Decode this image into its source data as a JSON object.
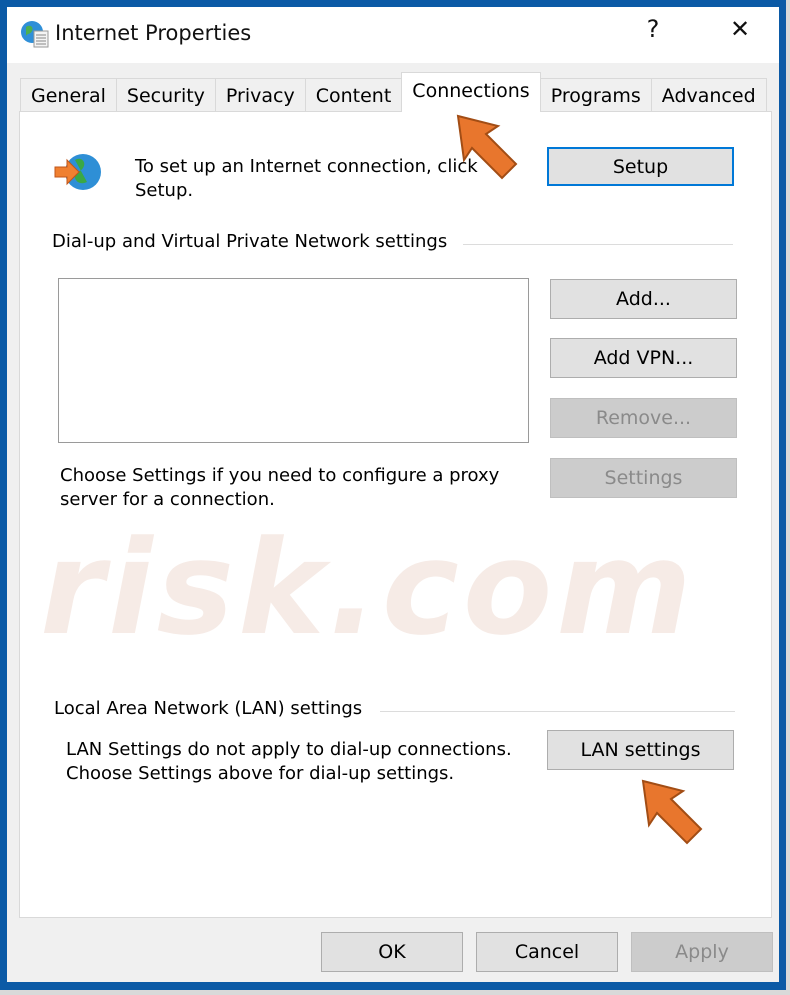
{
  "window": {
    "title": "Internet Properties",
    "help": "?",
    "close": "✕"
  },
  "tabs": [
    {
      "label": "General"
    },
    {
      "label": "Security"
    },
    {
      "label": "Privacy"
    },
    {
      "label": "Content"
    },
    {
      "label": "Connections",
      "active": true
    },
    {
      "label": "Programs"
    },
    {
      "label": "Advanced"
    }
  ],
  "setup": {
    "text": "To set up an Internet connection, click Setup.",
    "button": "Setup"
  },
  "dialup": {
    "heading": "Dial-up and Virtual Private Network settings",
    "add": "Add...",
    "add_vpn": "Add VPN...",
    "remove": "Remove...",
    "settings": "Settings",
    "proxy_text": "Choose Settings if you need to configure a proxy server for a connection."
  },
  "lan": {
    "heading": "Local Area Network (LAN) settings",
    "text": "LAN Settings do not apply to dial-up connections. Choose Settings above for dial-up settings.",
    "button": "LAN settings"
  },
  "footer": {
    "ok": "OK",
    "cancel": "Cancel",
    "apply": "Apply"
  },
  "watermark": "risk.com",
  "colors": {
    "accent": "#0078d7",
    "titlebar_border": "#0b5aa6",
    "arrow": "#e8762d"
  }
}
